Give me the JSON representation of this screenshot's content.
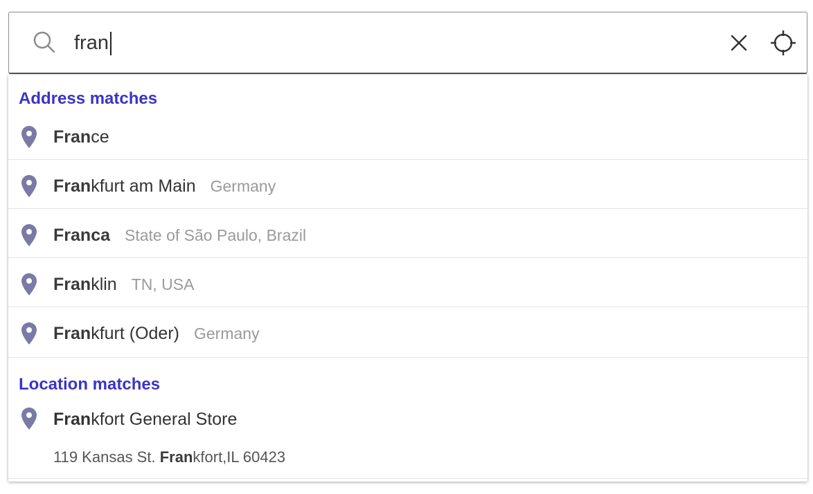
{
  "search": {
    "value": "fran",
    "icons": [
      "search-icon",
      "close-icon",
      "crosshair-icon"
    ]
  },
  "sections": {
    "address_heading": "Address matches",
    "location_heading": "Location matches"
  },
  "address_results": [
    {
      "match": "Fran",
      "rest": "ce",
      "secondary": ""
    },
    {
      "match": "Fran",
      "rest": "kfurt am Main",
      "secondary": "Germany"
    },
    {
      "match": "Fran",
      "rest": "ca",
      "secondary": "State of São Paulo, Brazil"
    },
    {
      "match": "Fran",
      "rest": "klin",
      "secondary": "TN, USA"
    },
    {
      "match": "Fran",
      "rest": "kfurt (Oder)",
      "secondary": "Germany"
    }
  ],
  "location_results": [
    {
      "title_match": "Fran",
      "title_rest": "kfort General Store",
      "address_prefix": "119 Kansas St. ",
      "address_match": "Fran",
      "address_rest": "kfort,IL 60423"
    }
  ],
  "colors": {
    "heading": "#3a34c6",
    "pin": "#7a7aa6",
    "secondary_text": "#9a9a9a"
  }
}
